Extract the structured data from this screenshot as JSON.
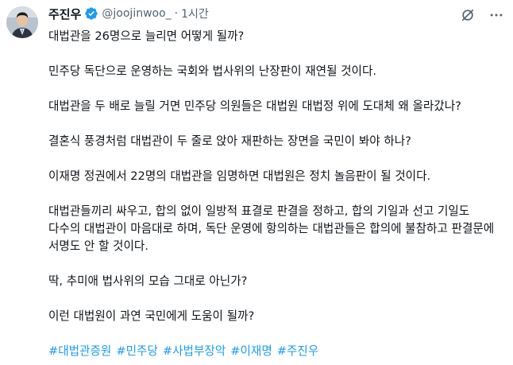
{
  "author": {
    "name": "주진우",
    "handle": "@joojinwoo_",
    "separator": "·",
    "time": "1시간"
  },
  "colors": {
    "text": "#0f1419",
    "secondary": "#536471",
    "link": "#1d9bf0",
    "verified": "#1d9bf0"
  },
  "icons": {
    "verified": "verified-badge-icon",
    "grok": "grok-icon",
    "more": "more-options-icon"
  },
  "body": {
    "paragraphs": [
      "대법관을 26명으로 늘리면 어떻게 될까?",
      "민주당 독단으로 운영하는 국회와 법사위의 난장판이 재연될 것이다.",
      "대법관을 두 배로 늘릴 거면 민주당 의원들은 대법원 대법정 위에 도대체 왜 올라갔나?",
      "결혼식 풍경처럼 대법관이 두 줄로 앉아 재판하는 장면을 국민이 봐야 하나?",
      "이재명 정권에서 22명의 대법관을 임명하면 대법원은 정치 놀음판이 될 것이다.",
      "대법관들끼리 싸우고, 합의 없이 일방적 표결로 판결을 정하고, 합의 기일과 선고 기일도 다수의 대법관이 마음대로 하며, 독단 운영에 항의하는 대법관들은 합의에 불참하고 판결문에 서명도 안 할 것이다.",
      "딱, 추미애 법사위의 모습 그대로 아닌가?",
      "이런 대법원이 과연 국민에게 도움이 될까?"
    ],
    "hashtags": [
      "#대법관증원",
      "#민주당",
      "#사법부장악",
      "#이재명",
      "#주진우"
    ]
  }
}
